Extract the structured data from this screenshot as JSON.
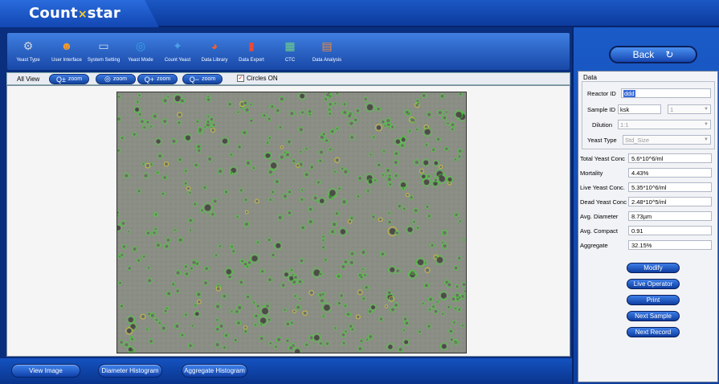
{
  "app": {
    "logo_left": "Count",
    "logo_mark": "×",
    "logo_right": "star"
  },
  "toolbar": {
    "items": [
      {
        "label": "Yeast Type",
        "icon": "yeast-type-icon",
        "glyph": "⚙",
        "color": "#cfd6e0"
      },
      {
        "label": "User Interface",
        "icon": "users-icon",
        "glyph": "☻",
        "color": "#f29a2e"
      },
      {
        "label": "System Setting",
        "icon": "laptop-icon",
        "glyph": "▭",
        "color": "#c8d8ee"
      },
      {
        "label": "Yeast Mode",
        "icon": "lifebuoy-icon",
        "glyph": "◎",
        "color": "#34a4e8"
      },
      {
        "label": "Count Yeast",
        "icon": "microscope-icon",
        "glyph": "✦",
        "color": "#4aa0e6"
      },
      {
        "label": "Data Library",
        "icon": "pie-chart-icon",
        "glyph": "◕",
        "color": "#e8623a"
      },
      {
        "label": "Data Export",
        "icon": "bar-chart-icon",
        "glyph": "▮",
        "color": "#e84a3a"
      },
      {
        "label": "CTC",
        "icon": "ctc-chart-icon",
        "glyph": "▦",
        "color": "#6ed08a"
      },
      {
        "label": "Data Analysis",
        "icon": "analysis-icon",
        "glyph": "▤",
        "color": "#f08a3a"
      }
    ]
  },
  "zoombar": {
    "all_view": "All View",
    "zoom_label": "zoom",
    "buttons": [
      {
        "glyph": "Q±",
        "name": "zoom-fit-button"
      },
      {
        "glyph": "◎",
        "name": "zoom-reset-button"
      },
      {
        "glyph": "Q+",
        "name": "zoom-in-button"
      },
      {
        "glyph": "Q−",
        "name": "zoom-out-button"
      }
    ],
    "circles_label": "Circles ON",
    "circles_checked": true
  },
  "bottombar": {
    "view_image": "View Image",
    "diameter_histogram": "Diameter Histogram",
    "aggregate_histogram": "Aggregate Histogram"
  },
  "right": {
    "back": "Back",
    "data_legend": "Data",
    "reactor_id_label": "Reactor ID",
    "reactor_id_value": "ddd",
    "sample_id_label": "Sample ID",
    "sample_id_value": "ksk",
    "sample_index": "1",
    "dilution_label": "Dilution",
    "dilution_value": "1:1",
    "yeast_type_label": "Yeast Type",
    "yeast_type_value": "Std_Size",
    "results": [
      {
        "label": "Total Yeast Conc",
        "value": "5.6*10^6/ml"
      },
      {
        "label": "Mortality",
        "value": "4.43%"
      },
      {
        "label": "Live Yeast Conc.",
        "value": "5.35*10^6/ml"
      },
      {
        "label": "Dead Yeast Conc",
        "value": "2.48*10^5/ml"
      },
      {
        "label": "Avg. Diameter",
        "value": "8.73µm"
      },
      {
        "label": "Avg. Compact",
        "value": "0.91"
      },
      {
        "label": "Aggregate",
        "value": "32.15%"
      }
    ],
    "buttons": {
      "modify": "Modify",
      "live_operator": "Live Operator",
      "print": "Print",
      "next_sample": "Next Sample",
      "next_record": "Next Record"
    }
  },
  "colors": {
    "accent": "#1247b3",
    "live_cell": "#3adc2a",
    "dead_cell": "#e8d21a",
    "image_bg": "#8a8e84"
  }
}
